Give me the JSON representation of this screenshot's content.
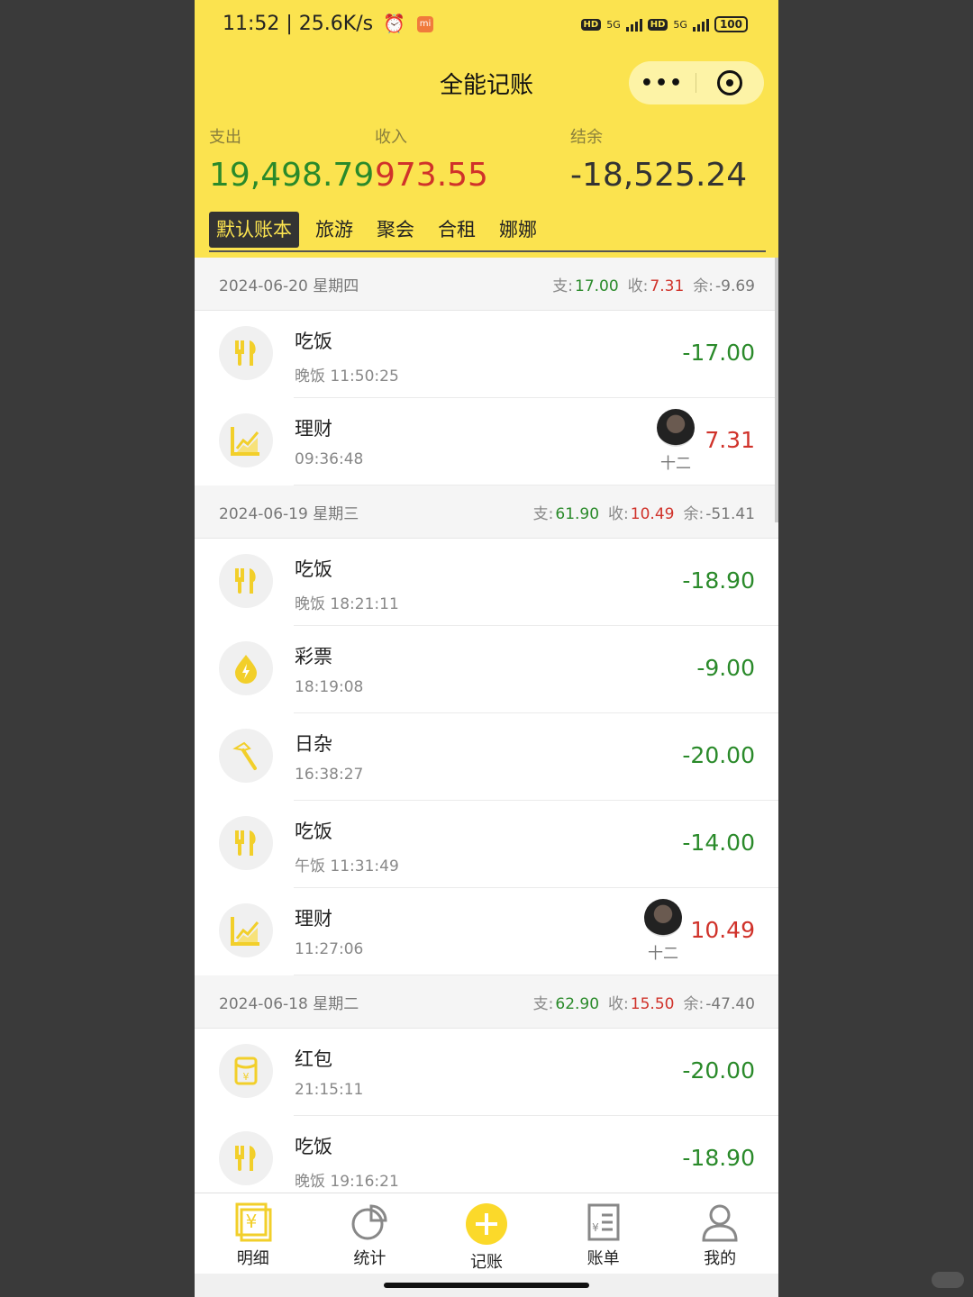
{
  "status": {
    "time_net": "11:52 | 25.6K/s",
    "mi_badge": "mi",
    "hd1": "HD",
    "net1": "5G",
    "hd2": "HD",
    "net2": "5G",
    "battery": "100"
  },
  "header": {
    "title": "全能记账",
    "capsule_more": "•••"
  },
  "summary": {
    "expense_label": "支出",
    "expense_value": "19,498.79",
    "income_label": "收入",
    "income_value": "973.55",
    "balance_label": "结余",
    "balance_value": "-18,525.24"
  },
  "tabs": [
    "默认账本",
    "旅游",
    "聚会",
    "合租",
    "娜娜"
  ],
  "day_labels": {
    "exp": "支:",
    "inc": "收:",
    "bal": "余:"
  },
  "days": [
    {
      "date": "2024-06-20 星期四",
      "expense": "17.00",
      "income": "7.31",
      "balance": "-9.69",
      "items": [
        {
          "icon": "fork-knife-icon",
          "category": "吃饭",
          "sub": "晚饭 11:50:25",
          "amount": "-17.00",
          "type": "expense"
        },
        {
          "icon": "trend-chart-icon",
          "category": "理财",
          "sub": "09:36:48",
          "amount": "7.31",
          "type": "income",
          "avatar_name": "十二"
        }
      ]
    },
    {
      "date": "2024-06-19 星期三",
      "expense": "61.90",
      "income": "10.49",
      "balance": "-51.41",
      "items": [
        {
          "icon": "fork-knife-icon",
          "category": "吃饭",
          "sub": "晚饭 18:21:11",
          "amount": "-18.90",
          "type": "expense"
        },
        {
          "icon": "lottery-drop-icon",
          "category": "彩票",
          "sub": "18:19:08",
          "amount": "-9.00",
          "type": "expense"
        },
        {
          "icon": "hammer-icon",
          "category": "日杂",
          "sub": "16:38:27",
          "amount": "-20.00",
          "type": "expense"
        },
        {
          "icon": "fork-knife-icon",
          "category": "吃饭",
          "sub": "午饭 11:31:49",
          "amount": "-14.00",
          "type": "expense"
        },
        {
          "icon": "trend-chart-icon",
          "category": "理财",
          "sub": "11:27:06",
          "amount": "10.49",
          "type": "income",
          "avatar_name": "十二"
        }
      ]
    },
    {
      "date": "2024-06-18 星期二",
      "expense": "62.90",
      "income": "15.50",
      "balance": "-47.40",
      "items": [
        {
          "icon": "red-envelope-icon",
          "category": "红包",
          "sub": "21:15:11",
          "amount": "-20.00",
          "type": "expense"
        },
        {
          "icon": "fork-knife-icon",
          "category": "吃饭",
          "sub": "晚饭 19:16:21",
          "amount": "-18.90",
          "type": "expense"
        }
      ]
    }
  ],
  "tabbar": [
    {
      "label": "明细",
      "icon": "yuan-note-icon"
    },
    {
      "label": "统计",
      "icon": "pie-chart-icon"
    },
    {
      "label": "记账",
      "icon": "plus-circle-icon"
    },
    {
      "label": "账单",
      "icon": "bill-icon"
    },
    {
      "label": "我的",
      "icon": "user-icon"
    }
  ],
  "colors": {
    "header_bg": "#fbe34f",
    "expense": "#2a8a2a",
    "income": "#d0322a",
    "accent": "#fbe34f"
  }
}
